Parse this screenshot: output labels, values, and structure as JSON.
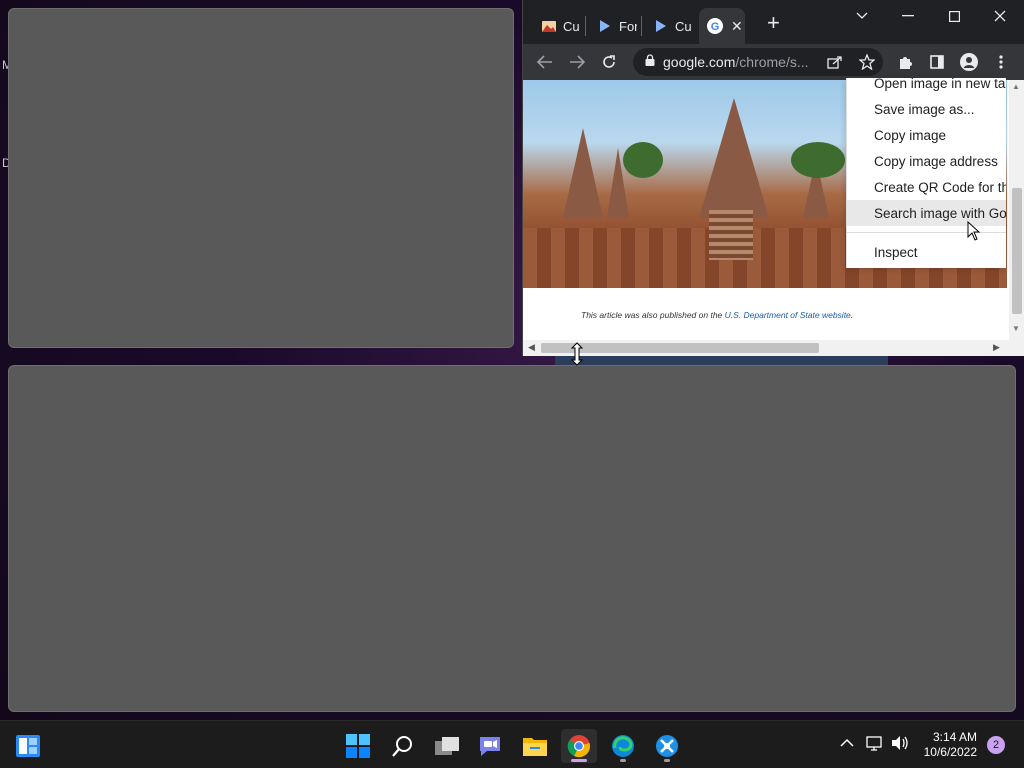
{
  "desktop": {
    "letters": [
      "M",
      "D"
    ]
  },
  "browser": {
    "tabs": [
      {
        "label": "Cu",
        "icon": "photo-icon"
      },
      {
        "label": "For",
        "icon": "play-icon"
      },
      {
        "label": "Cu",
        "icon": "play-icon"
      },
      {
        "label": "",
        "icon": "google-icon",
        "active": true
      }
    ],
    "window_controls": [
      "tab-search",
      "minimize",
      "maximize",
      "close"
    ],
    "address": {
      "host": "google.com",
      "path": "/chrome/s..."
    },
    "caption_text": "This article was also published on the ",
    "caption_link": "U.S. Department of State website",
    "caption_end": "."
  },
  "context_menu": {
    "items": [
      {
        "label": "Open image in new tab",
        "highlighted": false
      },
      {
        "label": "Save image as...",
        "highlighted": false
      },
      {
        "label": "Copy image",
        "highlighted": false
      },
      {
        "label": "Copy image address",
        "highlighted": false
      },
      {
        "label": "Create QR Code for this image",
        "highlighted": false
      },
      {
        "label": "Search image with Google",
        "highlighted": true
      },
      {
        "label": "Inspect",
        "highlighted": false
      }
    ]
  },
  "taskbar": {
    "apps": [
      {
        "name": "Start",
        "icon": "windows-logo-icon"
      },
      {
        "name": "Search",
        "icon": "search-icon"
      },
      {
        "name": "Task View",
        "icon": "task-view-icon"
      },
      {
        "name": "Chat",
        "icon": "chat-icon"
      },
      {
        "name": "File Explorer",
        "icon": "folder-icon"
      },
      {
        "name": "Chrome",
        "icon": "chrome-icon",
        "active": true
      },
      {
        "name": "Edge",
        "icon": "edge-icon"
      },
      {
        "name": "App",
        "icon": "app-icon"
      }
    ],
    "clock_time": "3:14 AM",
    "clock_date": "10/6/2022",
    "notification_count": "2",
    "accent": "#0a84ff"
  }
}
